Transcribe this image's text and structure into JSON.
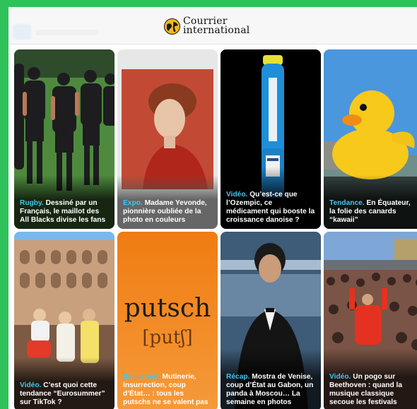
{
  "header": {
    "logo_line1": "Courrier",
    "logo_line2": "international"
  },
  "cards": [
    {
      "tag": "Rugby.",
      "title": "Dessiné par un Français, le maillot des All Blacks divise les fans"
    },
    {
      "tag": "Expo.",
      "title": "Madame Yevonde, pionnière oubliée de la photo en couleurs"
    },
    {
      "tag": "Vidéo.",
      "title": "Qu’est-ce que l’Ozempic, ce médicament qui booste la croissance danoise ?"
    },
    {
      "tag": "Tendance.",
      "title": "En Équateur, la folie des canards “kawaii”"
    },
    {
      "tag": "Vidéo.",
      "title": "C’est quoi cette tendance “Eurosummer” sur TikTok ?"
    },
    {
      "tag": "En un mot.",
      "title": "Mutinerie, insurrection, coup d’État… : tous les putschs ne se valent pas",
      "word": "putsch",
      "ipa": "[putʃ]"
    },
    {
      "tag": "Récap.",
      "title": "Mostra de Venise, coup d’État au Gabon, un panda à Moscou… La semaine en photos"
    },
    {
      "tag": "Vidéo.",
      "title": "Un pogo sur Beethoven : quand la musique classique secoue les festivals"
    }
  ],
  "colors": {
    "frame_green": "#2fc25b",
    "tag_blue": "#3ec8f0",
    "putsch_orange": "#f07c12"
  }
}
